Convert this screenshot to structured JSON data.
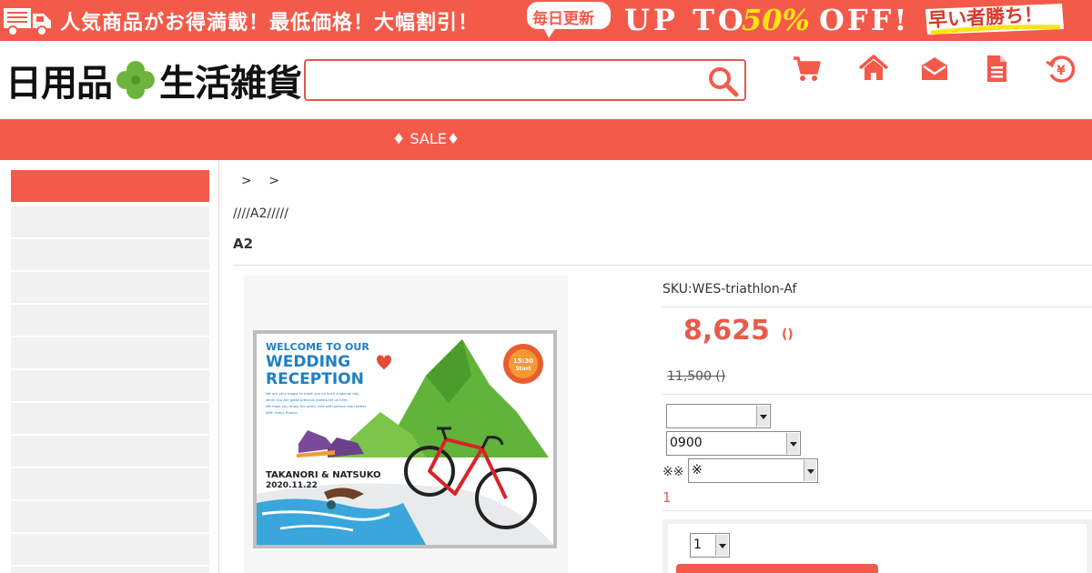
{
  "banner": {
    "main_text": "人気商品がお得満載！最低価格！大幅割引！",
    "badge_text": "毎日更新",
    "up_to": "UP TO",
    "percent": "50%",
    "off": "OFF!",
    "tagline": "早い者勝ち！"
  },
  "header": {
    "logo_left": "日用品",
    "logo_right": "生活雑貨",
    "search_placeholder": "",
    "icons": [
      "cart-icon",
      "home-icon",
      "mail-icon",
      "document-icon",
      "yen-history-icon"
    ]
  },
  "nav": {
    "sale_label": "♦ SALE♦"
  },
  "colors": {
    "brand": "#f35a4a",
    "price": "#e85b4a",
    "sidebar_item": "#f1f1f1"
  },
  "breadcrumb": {
    "sep1": ">",
    "sep2": ">"
  },
  "product": {
    "path": "////A2/////",
    "title": "A2",
    "sku": "SKU:WES-triathlon-Af",
    "price": "8,625",
    "price_unit": "()",
    "original_price": "11,500 ()",
    "select1_value": "",
    "select2_value": "0900",
    "option_label": "※※",
    "select3_value": "※",
    "stock": "1",
    "quantity": "1"
  },
  "poster": {
    "line1": "WELCOME TO OUR",
    "line2": "WEDDING",
    "line3": "RECEPTION",
    "time": "15:30",
    "start": "Start",
    "names": "TAKANORI & NATSUKO",
    "date": "2020.11.22",
    "message1": "We are very happy to meet you on such a special day,",
    "message2": "while you are gotta precious guests for us here.",
    "message3": "We hope you enjoy the party, and with person men better",
    "message4": "With many thanks."
  }
}
